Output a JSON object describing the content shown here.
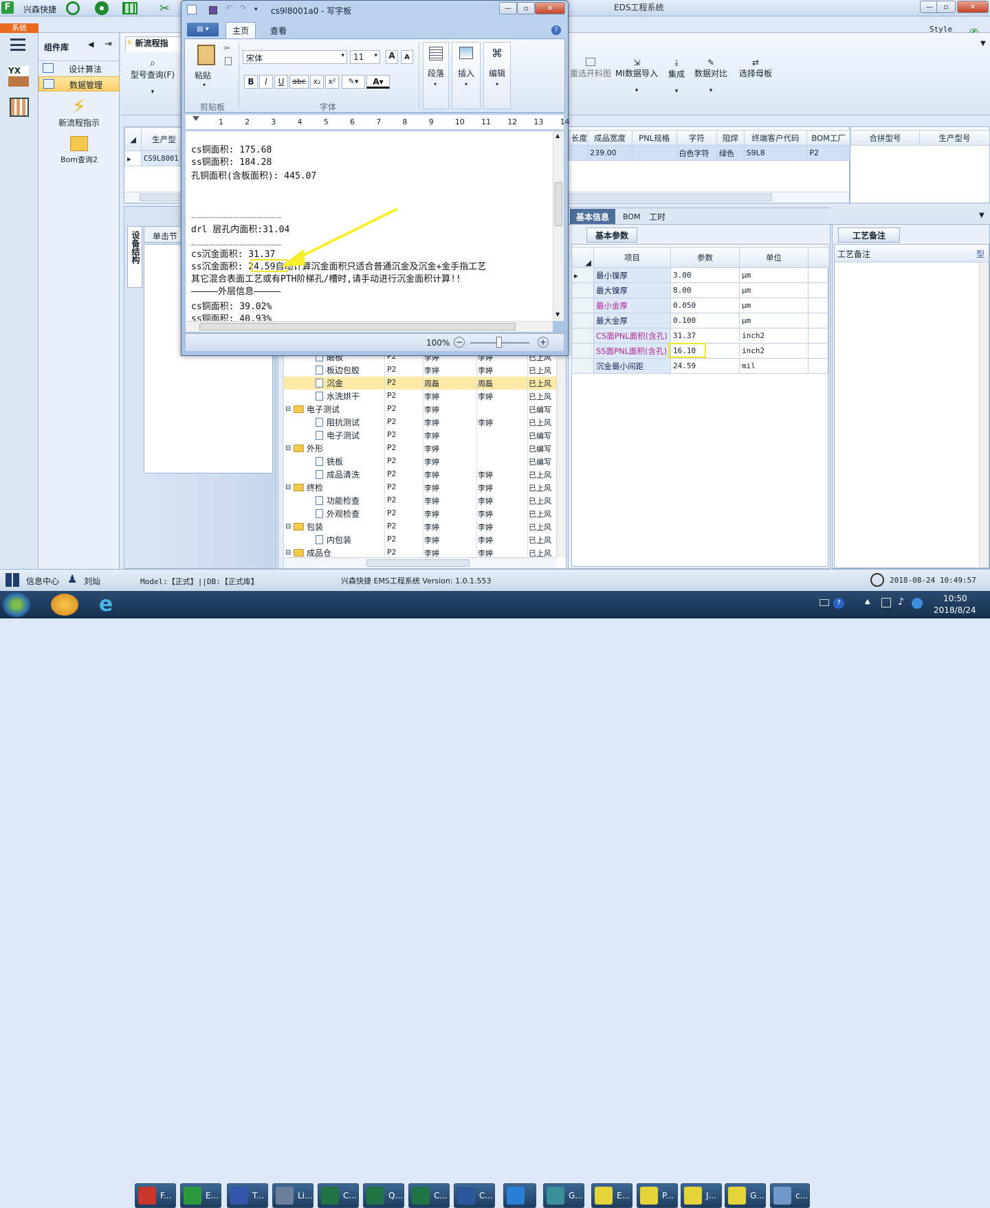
{
  "app": {
    "title": "EDS工程系统",
    "brand": "兴森快捷",
    "system_tab": "系统",
    "style_label": "Style"
  },
  "left_panel": {
    "title": "组件库",
    "items": [
      {
        "label": "设计算法"
      },
      {
        "label": "数据管理"
      }
    ],
    "launcher": [
      {
        "label": "新流程指示"
      },
      {
        "label": "Bom查询2"
      }
    ]
  },
  "ribbon": {
    "tab_label": "新流程指",
    "query_label": "型号查询(F)",
    "right_buttons": [
      {
        "label": "重选开料图"
      },
      {
        "label": "MI数据导入"
      },
      {
        "label": "集成"
      },
      {
        "label": "数据对比"
      },
      {
        "label": "选择母板"
      }
    ]
  },
  "top_grid": {
    "left_header": "生产型",
    "left_value": "CS9L8001",
    "columns": [
      "长度",
      "成品宽度",
      "PNL规格",
      "字符",
      "阻焊",
      "终端客户代码",
      "BOM工厂"
    ],
    "row": [
      "",
      "239.00",
      "",
      "白色字符",
      "绿色",
      "S9L8",
      "P2"
    ],
    "right_columns": [
      "合拼型号",
      "生产型号"
    ]
  },
  "side_tabs": {
    "vertical_label": "设备结构",
    "single_click": "单击节"
  },
  "tree": {
    "rows": [
      {
        "level": 2,
        "type": "doc",
        "label": "磨板",
        "f": "P2",
        "a": "李婷",
        "b": "李婷",
        "s": "已上风"
      },
      {
        "level": 2,
        "type": "doc",
        "label": "板边包胶",
        "f": "P2",
        "a": "李婷",
        "b": "李婷",
        "s": "已上风"
      },
      {
        "level": 2,
        "type": "doc",
        "label": "沉金",
        "f": "P2",
        "a": "周磊",
        "b": "周磊",
        "s": "已上风",
        "selected": true
      },
      {
        "level": 2,
        "type": "doc",
        "label": "水洗烘干",
        "f": "P2",
        "a": "李婷",
        "b": "李婷",
        "s": "已上风"
      },
      {
        "level": 1,
        "type": "folder",
        "label": "电子测试",
        "f": "P2",
        "a": "李婷",
        "b": "",
        "s": "已编写"
      },
      {
        "level": 2,
        "type": "doc",
        "label": "阻抗测试",
        "f": "P2",
        "a": "李婷",
        "b": "李婷",
        "s": "已上风"
      },
      {
        "level": 2,
        "type": "doc",
        "label": "电子测试",
        "f": "P2",
        "a": "李婷",
        "b": "",
        "s": "已编写"
      },
      {
        "level": 1,
        "type": "folder",
        "label": "外形",
        "f": "P2",
        "a": "李婷",
        "b": "",
        "s": "已编写"
      },
      {
        "level": 2,
        "type": "doc",
        "label": "铣板",
        "f": "P2",
        "a": "李婷",
        "b": "",
        "s": "已编写"
      },
      {
        "level": 2,
        "type": "doc",
        "label": "成品清洗",
        "f": "P2",
        "a": "李婷",
        "b": "李婷",
        "s": "已上风"
      },
      {
        "level": 1,
        "type": "folder",
        "label": "终检",
        "f": "P2",
        "a": "李婷",
        "b": "李婷",
        "s": "已上风"
      },
      {
        "level": 2,
        "type": "doc",
        "label": "功能检查",
        "f": "P2",
        "a": "李婷",
        "b": "李婷",
        "s": "已上风"
      },
      {
        "level": 2,
        "type": "doc",
        "label": "外观检查",
        "f": "P2",
        "a": "李婷",
        "b": "李婷",
        "s": "已上风"
      },
      {
        "level": 1,
        "type": "folder",
        "label": "包装",
        "f": "P2",
        "a": "李婷",
        "b": "李婷",
        "s": "已上风"
      },
      {
        "level": 2,
        "type": "doc",
        "label": "内包装",
        "f": "P2",
        "a": "李婷",
        "b": "李婷",
        "s": "已上风"
      },
      {
        "level": 1,
        "type": "folder",
        "label": "成品仓",
        "f": "P2",
        "a": "李婷",
        "b": "李婷",
        "s": "已上风"
      }
    ]
  },
  "info_panel": {
    "tabs": [
      "基本信息",
      "BOM",
      "工时"
    ],
    "subtab": "基本参数",
    "headers": [
      "项目",
      "参数",
      "单位"
    ],
    "params": [
      {
        "name": "最小镍厚",
        "value": "3.00",
        "unit": "μm",
        "color": "#1a2a5a"
      },
      {
        "name": "最大镍厚",
        "value": "8.00",
        "unit": "μm",
        "color": "#1a2a5a"
      },
      {
        "name": "最小金厚",
        "value": "0.050",
        "unit": "μm",
        "color": "#b0279a"
      },
      {
        "name": "最大金厚",
        "value": "0.100",
        "unit": "μm",
        "color": "#1a2a5a"
      },
      {
        "name": "CS面PNL面积(含孔)",
        "value": "31.37",
        "unit": "inch2",
        "color": "#b0279a"
      },
      {
        "name": "SS面PNL面积(含孔)",
        "value": "16.10",
        "unit": "inch2",
        "color": "#b0279a"
      },
      {
        "name": "沉金最小间距",
        "value": "24.59",
        "unit": "mil",
        "color": "#1a2a5a"
      }
    ],
    "remark_tab": "工艺备注",
    "remark_header": "工艺备注",
    "remark_col2": "型"
  },
  "wordpad": {
    "title": "cs9l8001a0 - 写字板",
    "tabs": [
      "主页",
      "查看"
    ],
    "font_name": "宋体",
    "font_size": "11",
    "groups": {
      "clipboard": "剪贴板",
      "font": "字体"
    },
    "buttons": {
      "paste": "粘贴",
      "paragraph": "段落",
      "insert": "插入",
      "edit": "编辑"
    },
    "ruler_numbers": [
      "1",
      "2",
      "3",
      "4",
      "5",
      "6",
      "7",
      "8",
      "9",
      "10",
      "11",
      "12",
      "13",
      "14"
    ],
    "lines": [
      "cs铜面积: 175.68",
      "ss铜面积: 184.28",
      "孔铜面积(含板面积): 445.07",
      "",
      "_______________",
      "drl           层孔内面积:31.04",
      "",
      "_______________",
      "cs沉金面积: 31.37",
      "ss沉金面积: 24.59自动计算沉金面积只适合普通沉金及沉金+金手指工艺",
      "其它混合表面工艺或有PTH阶梯孔/槽时,请手动进行沉金面积计算!!",
      "—————外层信息—————",
      "cs铜面积: 39.02%",
      "ss铜面积: 40.93%"
    ],
    "zoom": "100%"
  },
  "status_bar": {
    "info_center": "信息中心",
    "user": "刘灿",
    "model": "Model:【正式】||DB:【正式库】",
    "version": "兴森快捷 EMS工程系统 Version: 1.0.1.553",
    "datetime": "2018-08-24 10:49:57"
  },
  "taskbar": {
    "items": [
      {
        "label": "F...",
        "color": "#c8352a"
      },
      {
        "label": "E...",
        "color": "#2b9a3c"
      },
      {
        "label": "T...",
        "color": "#3556a8"
      },
      {
        "label": "Li...",
        "color": "#6c7f9a"
      },
      {
        "label": "C...",
        "color": "#217346"
      },
      {
        "label": "Q...",
        "color": "#217346"
      },
      {
        "label": "C...",
        "color": "#217346"
      },
      {
        "label": "C...",
        "color": "#2b579a"
      },
      {
        "label": "",
        "color": "#2a7fd4"
      },
      {
        "label": "G...",
        "color": "#3a8f9a"
      },
      {
        "label": "E...",
        "color": "#e5d33a"
      },
      {
        "label": "P...",
        "color": "#e5d33a"
      },
      {
        "label": "J...",
        "color": "#e5d33a"
      },
      {
        "label": "G...",
        "color": "#e5d33a"
      },
      {
        "label": "c...",
        "color": "#6f98c9"
      }
    ],
    "time": "10:50",
    "date": "2018/8/24"
  }
}
